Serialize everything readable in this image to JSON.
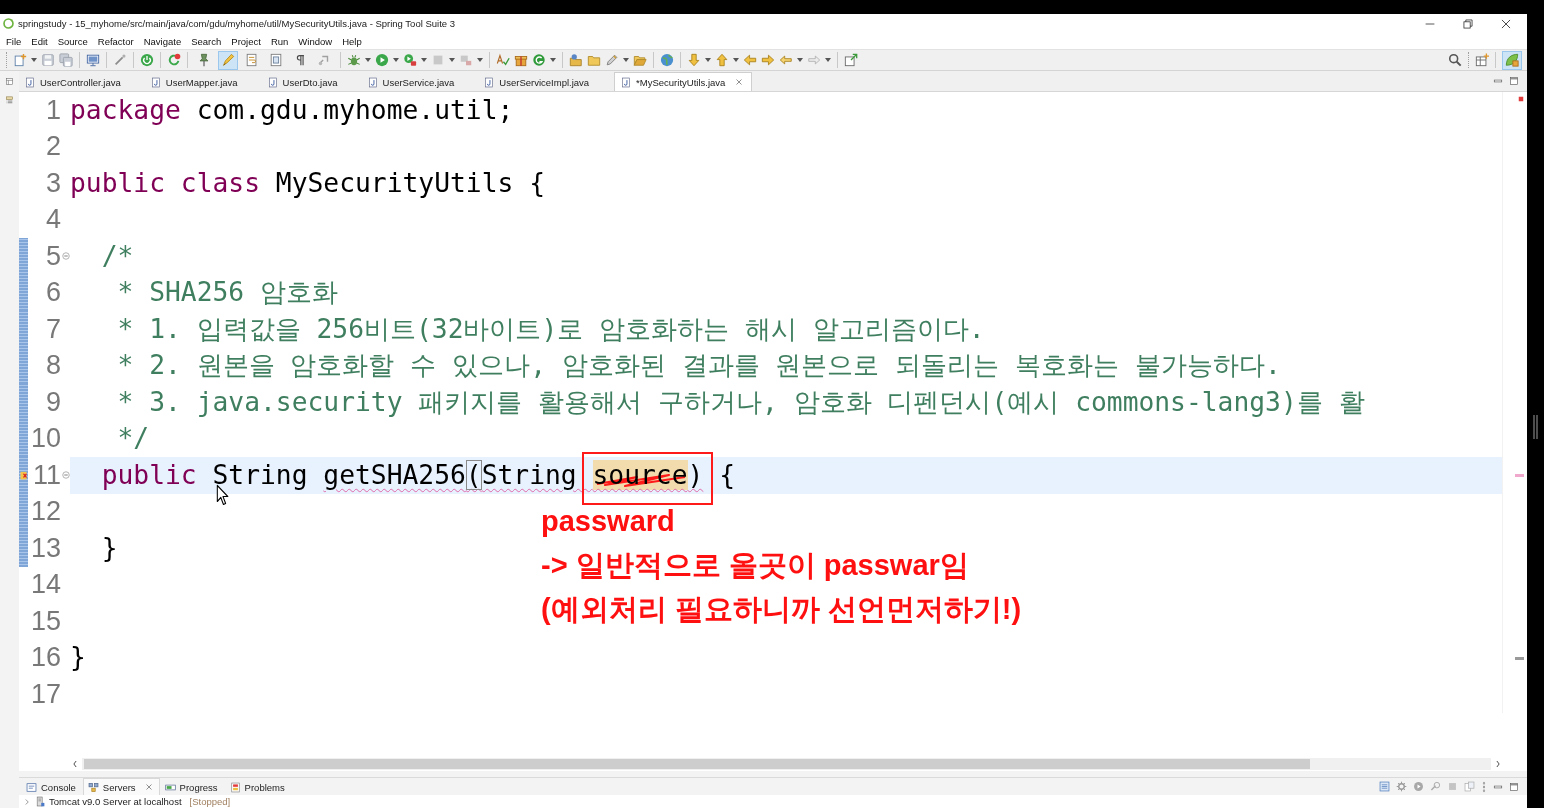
{
  "window": {
    "title": "springstudy - 15_myhome/src/main/java/com/gdu/myhome/util/MySecurityUtils.java - Spring Tool Suite 3"
  },
  "menu": [
    "File",
    "Edit",
    "Source",
    "Refactor",
    "Navigate",
    "Search",
    "Project",
    "Run",
    "Window",
    "Help"
  ],
  "toolbar": {
    "toggles": [
      {
        "kind": "pin",
        "on": false
      },
      {
        "kind": "highlight",
        "on": true
      },
      {
        "kind": "wrap",
        "on": false
      },
      {
        "kind": "block",
        "on": false
      },
      {
        "kind": "whitespace",
        "on": false
      },
      {
        "kind": "link",
        "on": false
      }
    ]
  },
  "perspectives": [
    {
      "kind": "spring",
      "selected": true
    }
  ],
  "editor_tabs": [
    {
      "label": "UserController.java",
      "selected": false
    },
    {
      "label": "UserMapper.java",
      "selected": false
    },
    {
      "label": "UserDto.java",
      "selected": false
    },
    {
      "label": "UserService.java",
      "selected": false
    },
    {
      "label": "UserServiceImpl.java",
      "selected": false
    },
    {
      "label": "*MySecurityUtils.java",
      "selected": true
    }
  ],
  "editor": {
    "lines": [
      {
        "number": "1",
        "changed": false,
        "current": false,
        "fold": false,
        "problem": false,
        "tokens": [
          {
            "kind": "keyword",
            "text": "package"
          },
          {
            "kind": "plain",
            "text": " com.gdu.myhome.util;"
          }
        ]
      },
      {
        "number": "2",
        "changed": false,
        "current": false,
        "fold": false,
        "problem": false
      },
      {
        "number": "3",
        "changed": false,
        "current": false,
        "fold": false,
        "problem": false,
        "tokens": [
          {
            "kind": "keyword",
            "text": "public class"
          },
          {
            "kind": "plain",
            "text": " MySecurityUtils {"
          }
        ]
      },
      {
        "number": "4",
        "changed": false,
        "current": false,
        "fold": false,
        "problem": false
      },
      {
        "number": "5",
        "changed": true,
        "current": false,
        "fold": true,
        "problem": false,
        "tokens": [
          {
            "kind": "comment",
            "text": "  /*"
          }
        ]
      },
      {
        "number": "6",
        "changed": true,
        "current": false,
        "fold": false,
        "problem": false,
        "tokens": [
          {
            "kind": "comment",
            "text": "   * SHA256 암호화"
          }
        ]
      },
      {
        "number": "7",
        "changed": true,
        "current": false,
        "fold": false,
        "problem": false,
        "tokens": [
          {
            "kind": "comment",
            "text": "   * 1. 입력값을 256비트(32바이트)로 암호화하는 해시 알고리즘이다."
          }
        ]
      },
      {
        "number": "8",
        "changed": true,
        "current": false,
        "fold": false,
        "problem": false,
        "tokens": [
          {
            "kind": "comment",
            "text": "   * 2. 원본을 암호화할 수 있으나, 암호화된 결과를 원본으로 되돌리는 복호화는 불가능하다."
          }
        ]
      },
      {
        "number": "9",
        "changed": true,
        "current": false,
        "fold": false,
        "problem": false,
        "tokens": [
          {
            "kind": "comment",
            "text": "   * 3. java.security 패키지를 활용해서 구하거나, 암호화 디펜던시(예시 commons-lang3)를 활"
          }
        ]
      },
      {
        "number": "10",
        "changed": true,
        "current": false,
        "fold": false,
        "problem": false,
        "tokens": [
          {
            "kind": "comment",
            "text": "   */"
          }
        ]
      },
      {
        "number": "11",
        "changed": true,
        "current": true,
        "fold": true,
        "problem": true,
        "tokens": [
          {
            "kind": "keyword",
            "text": "  public"
          },
          {
            "kind": "plain",
            "text": " String "
          },
          {
            "kind": "warning",
            "text": "getSHA256"
          },
          {
            "kind": "bracket",
            "text": "("
          },
          {
            "kind": "warning",
            "text": "String "
          },
          {
            "kind": "annotated",
            "text": "source"
          },
          {
            "kind": "warning",
            "text": ")"
          },
          {
            "kind": "plain",
            "text": " {"
          }
        ]
      },
      {
        "number": "12",
        "changed": true,
        "current": false,
        "fold": false,
        "problem": false
      },
      {
        "number": "13",
        "changed": true,
        "current": false,
        "fold": false,
        "problem": false,
        "tokens": [
          {
            "kind": "plain",
            "text": "  }"
          }
        ]
      },
      {
        "number": "14",
        "changed": false,
        "current": false,
        "fold": false,
        "problem": false
      },
      {
        "number": "15",
        "changed": false,
        "current": false,
        "fold": false,
        "problem": false
      },
      {
        "number": "16",
        "changed": false,
        "current": false,
        "fold": false,
        "problem": false,
        "tokens": [
          {
            "kind": "plain",
            "text": "}"
          }
        ]
      },
      {
        "number": "17",
        "changed": false,
        "current": false,
        "fold": false,
        "problem": false
      }
    ]
  },
  "note": {
    "lines": [
      "passward",
      "-> 일반적으로 올곳이 passwar임",
      "(예외처리 필요하니까 선언먼저하기!)"
    ]
  },
  "bottom_panel": {
    "tabs": [
      {
        "kind": "console",
        "label": "Console",
        "selected": false
      },
      {
        "kind": "servers",
        "label": "Servers",
        "selected": true
      },
      {
        "kind": "progress",
        "label": "Progress",
        "selected": false
      },
      {
        "kind": "problems",
        "label": "Problems",
        "selected": false
      }
    ],
    "servers": [
      {
        "name": "Tomcat v9.0 Server at localhost",
        "status": "[Stopped]",
        "expanded": false
      }
    ]
  }
}
